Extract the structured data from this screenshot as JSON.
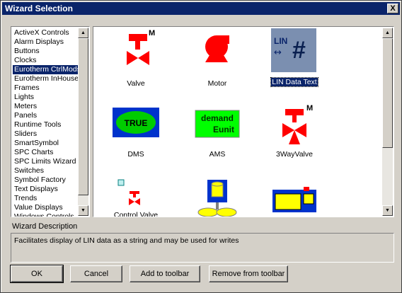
{
  "window": {
    "title": "Wizard Selection",
    "close_glyph": "X"
  },
  "categories": [
    {
      "label": "ActiveX Controls"
    },
    {
      "label": "Alarm Displays"
    },
    {
      "label": "Buttons"
    },
    {
      "label": "Clocks"
    },
    {
      "label": "Eurotherm CtrlMods",
      "selected": true
    },
    {
      "label": "Eurotherm InHouse"
    },
    {
      "label": "Frames"
    },
    {
      "label": "Lights"
    },
    {
      "label": "Meters"
    },
    {
      "label": "Panels"
    },
    {
      "label": "Runtime Tools"
    },
    {
      "label": "Sliders"
    },
    {
      "label": "SmartSymbol"
    },
    {
      "label": "SPC Charts"
    },
    {
      "label": "SPC Limits Wizard"
    },
    {
      "label": "Switches"
    },
    {
      "label": "Symbol Factory"
    },
    {
      "label": "Text Displays"
    },
    {
      "label": "Trends"
    },
    {
      "label": "Value Displays"
    },
    {
      "label": "Windows Controls"
    }
  ],
  "wizards": [
    {
      "label": "Valve",
      "icon": "valve-m-icon"
    },
    {
      "label": "Motor",
      "icon": "motor-icon"
    },
    {
      "label": "LIN Data Text",
      "icon": "lin-data-text-icon",
      "selected": true
    },
    {
      "label": "DMS",
      "icon": "dms-true-icon"
    },
    {
      "label": "AMS",
      "icon": "ams-demand-eunit-icon"
    },
    {
      "label": "3WayValve",
      "icon": "three-way-valve-icon"
    },
    {
      "label": "Control Valve",
      "icon": "control-valve-icon"
    },
    {
      "label": "",
      "icon": "tank-agitator-icon"
    },
    {
      "label": "",
      "icon": "panel-display-icon"
    }
  ],
  "icon_text": {
    "lin": "LIN",
    "arrow": "↔",
    "hash": "#",
    "true": "TRUE",
    "demand": "demand",
    "eunit": "Eunit",
    "m": "M"
  },
  "description": {
    "label": "Wizard Description",
    "text": "Facilitates display of LIN data as a string and may be used for writes"
  },
  "buttons": {
    "ok": "OK",
    "cancel": "Cancel",
    "add": "Add to toolbar",
    "remove": "Remove from  toolbar"
  },
  "colors": {
    "title_bar": "#0a246a",
    "selection": "#0a246a",
    "valve_red": "#ff0000",
    "dms_green": "#00cc00",
    "ams_green": "#00ff00",
    "lin_bg": "#7b8fb0"
  }
}
